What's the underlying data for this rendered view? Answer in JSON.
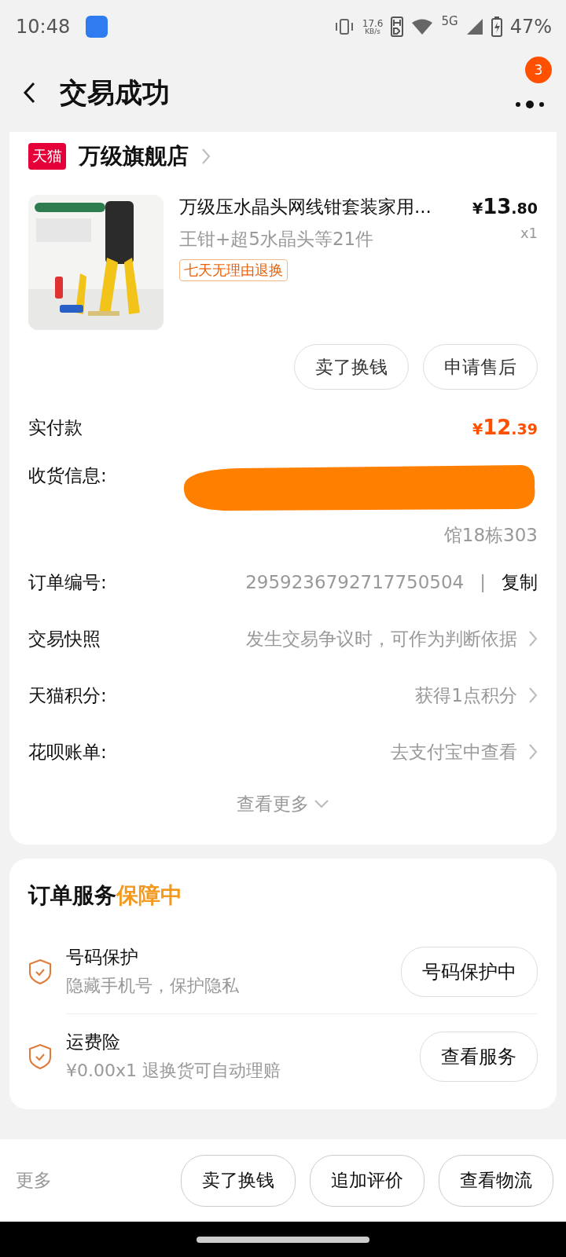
{
  "status_bar": {
    "time": "10:48",
    "speed_value": "17.6",
    "speed_unit": "KB/s",
    "network": "5G",
    "battery": "47%"
  },
  "header": {
    "title": "交易成功",
    "badge": "3"
  },
  "store": {
    "badge": "天猫",
    "name": "万级旗舰店"
  },
  "product": {
    "kind": "picture",
    "title": "万级压水晶头网线钳套装家用...",
    "spec": "王钳+超5水晶头等21件",
    "tag": "七天无理由退换",
    "price": {
      "symbol": "¥",
      "integer": "13",
      "decimal": ".80"
    },
    "quantity": "x1"
  },
  "item_buttons": [
    "卖了换钱",
    "申请售后"
  ],
  "paid": {
    "label": "实付款",
    "price": {
      "symbol": "¥",
      "integer": "12",
      "decimal": ".39"
    }
  },
  "address": {
    "label": "收货信息:",
    "redacted": true,
    "last_line": "馆18栋303"
  },
  "order_number": {
    "label": "订单编号:",
    "value": "2959236792717750504",
    "separator": "|",
    "action": "复制"
  },
  "info_rows": [
    {
      "label": "交易快照",
      "value": "发生交易争议时，可作为判断依据"
    },
    {
      "label": "天猫积分:",
      "value": "获得1点积分"
    },
    {
      "label": "花呗账单:",
      "value": "去支付宝中查看"
    }
  ],
  "more": "查看更多",
  "services": {
    "title": "订单服务",
    "title_highlight": "保障中",
    "items": [
      {
        "name": "号码保护",
        "description": "隐藏手机号，保护隐私",
        "button": "号码保护中"
      },
      {
        "name": "运费险",
        "description": "¥0.00x1 退换货可自动理赔",
        "button": "查看服务"
      }
    ]
  },
  "bottom_bar": {
    "more": "更多",
    "buttons": [
      "卖了换钱",
      "追加评价",
      "查看物流"
    ]
  }
}
